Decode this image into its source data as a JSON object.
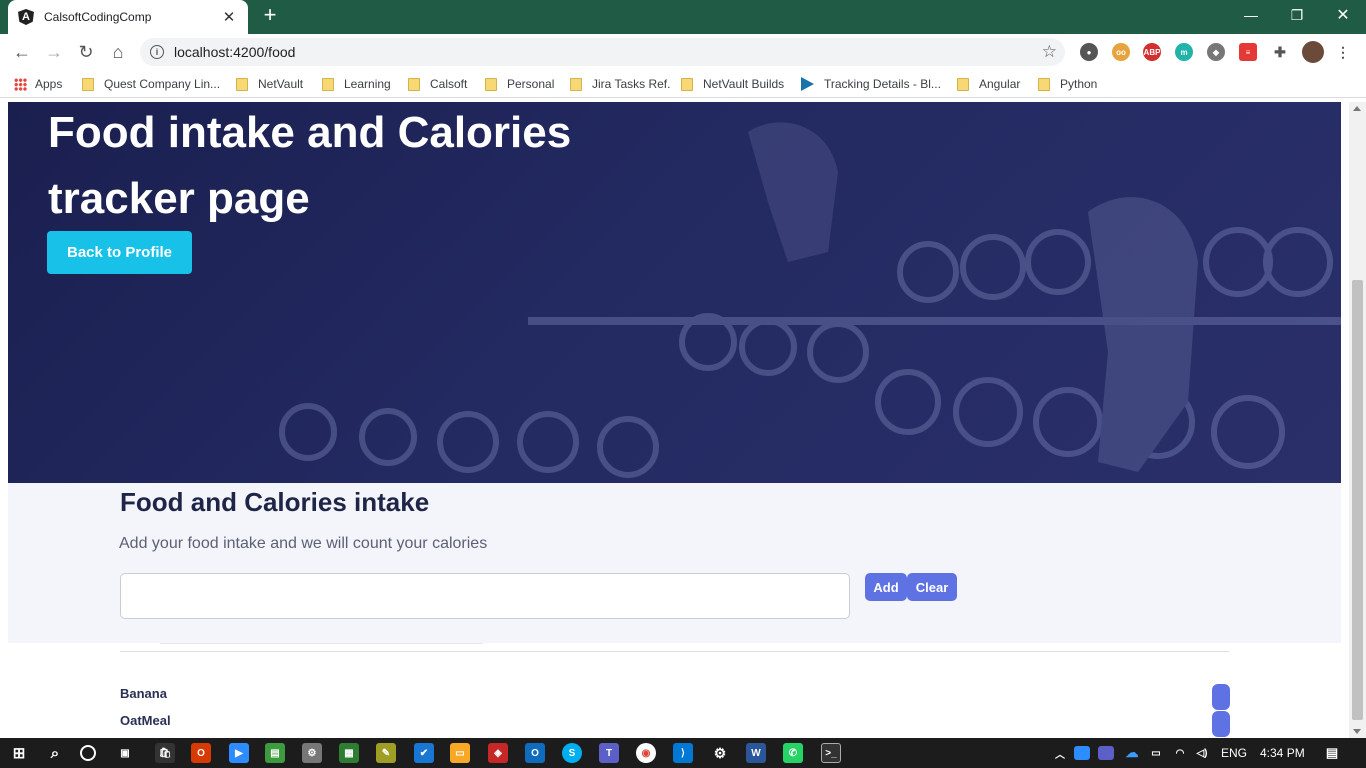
{
  "browser": {
    "tab_title": "CalsoftCodingComp",
    "url": "localhost:4200/food",
    "bookmarks": [
      "Apps",
      "Quest Company Lin...",
      "NetVault",
      "Learning",
      "Calsoft",
      "Personal",
      "Jira Tasks Ref.",
      "NetVault Builds",
      "Tracking Details - Bl...",
      "Angular",
      "Python"
    ]
  },
  "hero": {
    "title": "Food intake and Calories tracker page",
    "back_button": "Back to Profile"
  },
  "food_section": {
    "title": "Food and Calories intake",
    "subtitle": "Add your food intake and we will count your calories",
    "input_value": "",
    "add_button": "Add",
    "clear_button": "Clear",
    "items": [
      "Banana",
      "OatMeal"
    ]
  },
  "taskbar": {
    "language": "ENG",
    "time": "4:34 PM"
  },
  "colors": {
    "accent_cyan": "#17c1e8",
    "accent_indigo": "#5e72e4",
    "hero_bg": "#1f255a",
    "titlebar": "#1f5b45"
  }
}
